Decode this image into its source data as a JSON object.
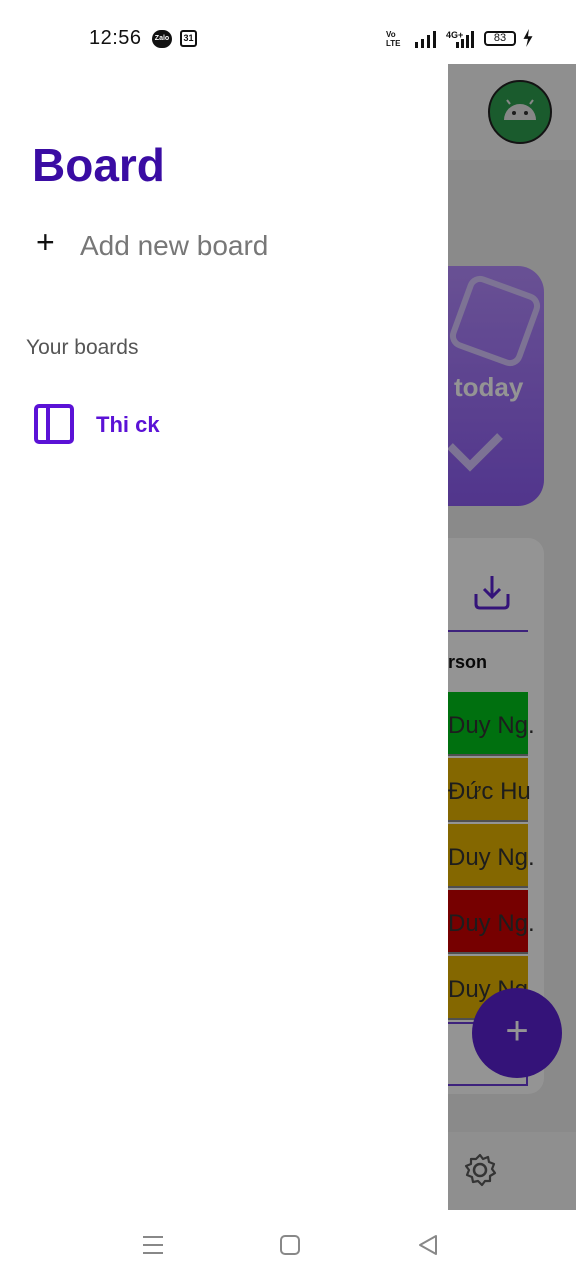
{
  "status_bar": {
    "time": "12:56",
    "icons": [
      "zalo-icon",
      "calendar-icon",
      "volte-icon",
      "signal-icon",
      "4g-signal-icon",
      "battery-icon",
      "charging-icon"
    ],
    "calendar_day": "31",
    "zalo_text": "Zalo",
    "volte_text": "Vo LTE",
    "network": "4G+",
    "battery": "83"
  },
  "drawer": {
    "title": "Board",
    "add_label": "Add new board",
    "section_label": "Your boards",
    "boards": [
      {
        "label": "Thi ck"
      }
    ]
  },
  "background": {
    "promo_text": "today",
    "column_header": "rson",
    "rows": [
      {
        "text": "Duy Ng.",
        "color": "#00c21b"
      },
      {
        "text": "Đức Hu",
        "color": "#e3b200"
      },
      {
        "text": "Duy Ng.",
        "color": "#e3b200"
      },
      {
        "text": "Duy Ng.",
        "color": "#cc0000"
      },
      {
        "text": "Duy Ng.",
        "color": "#e3b200"
      }
    ],
    "fab_label": "+"
  },
  "colors": {
    "accent": "#3a0ca3",
    "board_item": "#5b12d6",
    "fab": "#5b21d0"
  },
  "nav": {
    "buttons": [
      "recent-apps",
      "home",
      "back"
    ]
  }
}
